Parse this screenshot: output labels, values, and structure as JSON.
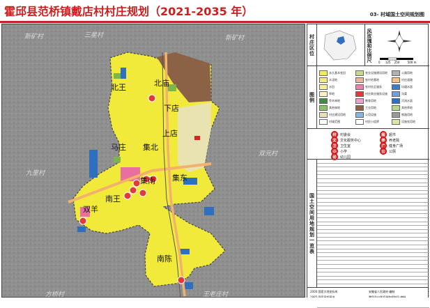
{
  "header": {
    "title": "霍邱县范桥镇戴店村村庄规划（2021-2035 年）",
    "sheet_title": "03- 村域国土空间规划图"
  },
  "map": {
    "village_labels": [
      "北王",
      "北庙",
      "下店",
      "上店",
      "马庄",
      "集北",
      "集南",
      "集东",
      "南王",
      "双羊",
      "南陈"
    ],
    "background_labels": [
      "新矿村",
      "三星村",
      "新矿村",
      "双元村",
      "九里村",
      "方桥村",
      "王老庄村"
    ],
    "colors": {
      "village_land": "#f2ea3a",
      "residential_beige": "#e8e3b0",
      "industrial_brown": "#8b6246",
      "water_blue": "#2e6fbf",
      "green_space": "#7ab648",
      "public_pink": "#e86fa0",
      "road_orange": "#f2b26d",
      "public_red": "#e02020",
      "base_grey": "#8a8a8a"
    }
  },
  "panel": {
    "location_label": "村庄区位",
    "compass_label": "风玫瑰和比例尺",
    "scale_ticks": [
      "0",
      "125",
      "250",
      "500"
    ],
    "scale_unit": "m",
    "legend_label": "图例",
    "legend_items": [
      {
        "label": "永久基本农田",
        "color": "#f4ed55"
      },
      {
        "label": "农业设施建设用地",
        "color": "#c9d98b"
      },
      {
        "label": "公路用地",
        "color": "#b3b3b3"
      },
      {
        "label": "水浇地",
        "color": "#f5e88a"
      },
      {
        "label": "农村宅基地",
        "color": "#e8b89a"
      },
      {
        "label": "村庄道路",
        "color": "#f2c38b"
      },
      {
        "label": "水田",
        "color": "#f7f09a"
      },
      {
        "label": "农村社区服务",
        "color": "#f07fb0"
      },
      {
        "label": "坑塘水面",
        "color": "#3a7bd5"
      },
      {
        "label": "旱地",
        "color": "#f7f3c2"
      },
      {
        "label": "村庄商业服务设施",
        "color": "#e03b3b"
      },
      {
        "label": "沟渠",
        "color": "#6fa0e0"
      },
      {
        "label": "乔木林地",
        "color": "#3f8f3f"
      },
      {
        "label": "教育用地",
        "color": "#f0a0c8"
      },
      {
        "label": "河流水面",
        "color": "#2e6fbf"
      },
      {
        "label": "其他林地",
        "color": "#8cc26a"
      },
      {
        "label": "工业用地",
        "color": "#8b6246"
      },
      {
        "label": "其他草地",
        "color": "#b5d88f"
      },
      {
        "label": "村庄建设用地",
        "color": "#e8e3b0"
      },
      {
        "label": "公用设施",
        "color": "#7fb8e6"
      },
      {
        "label": "铁路用地",
        "color": "#999999"
      },
      {
        "label": "村域范围",
        "color": "#ffffff"
      },
      {
        "label": "村民小组界",
        "color": "#ffffff"
      },
      {
        "label": "设施农用地",
        "color": "#d8e6a8"
      }
    ],
    "symbols": [
      {
        "code": "村",
        "label": "村委会"
      },
      {
        "code": "超",
        "label": "超市"
      },
      {
        "code": "文",
        "label": "文化服务中心"
      },
      {
        "code": "养",
        "label": "养老院"
      },
      {
        "code": "卫",
        "label": "卫生室"
      },
      {
        "code": "广",
        "label": "健身广场"
      },
      {
        "code": "小",
        "label": "小学"
      },
      {
        "code": "公",
        "label": "公厕"
      },
      {
        "code": "幼",
        "label": "幼儿园"
      }
    ],
    "table_label": "国土空间用地规划一览表",
    "footer": {
      "left1": "2000 国家大地坐标系",
      "left2": "1985 国家高程基准",
      "right1": "安徽省人民政府 编制",
      "right2": "霍邱县自然资源和规划局 编制"
    }
  }
}
